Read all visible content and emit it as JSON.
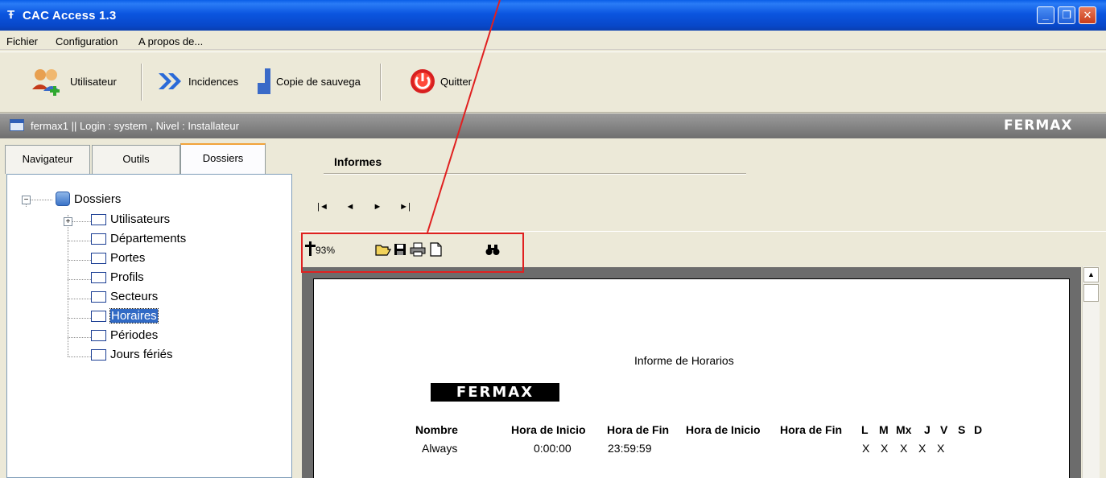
{
  "window": {
    "title": "CAC Access 1.3",
    "icon": "app-icon",
    "minimize": "_",
    "maximize": "❐",
    "close": "✕"
  },
  "menu": [
    "Fichier",
    "Configuration",
    "A propos de..."
  ],
  "toolbar": {
    "utilisateur": "Utilisateur",
    "incidences": "Incidences",
    "copie": "Copie de sauvega",
    "quitter": "Quitter"
  },
  "session": {
    "text": "fermax1  || Login : system , Nivel : Installateur",
    "brand": "FERMAX"
  },
  "tabs": [
    "Navigateur",
    "Outils",
    "Dossiers"
  ],
  "tabs_active": "Dossiers",
  "tree": {
    "root": "Dossiers",
    "items": [
      "Utilisateurs",
      "Départements",
      "Portes",
      "Profils",
      "Secteurs",
      "Horaires",
      "Périodes",
      "Jours fériés"
    ],
    "selected": "Horaires"
  },
  "report_viewer": {
    "section_title": "Informes",
    "nav": [
      "|◄",
      "◄",
      "►",
      "►|"
    ],
    "zoom": "93%",
    "icons": [
      "zoom-icon",
      "open-folder-icon",
      "save-icon",
      "print-icon",
      "page-icon",
      "find-icon"
    ]
  },
  "report": {
    "title": "Informe de Horarios",
    "logo": "FERMAX",
    "columns": [
      "Nombre",
      "Hora de Inicio",
      "Hora de Fin",
      "Hora de Inicio",
      "Hora de Fin",
      "L",
      "M",
      "Mx",
      "J",
      "V",
      "S",
      "D"
    ],
    "rows": [
      [
        "Always",
        "0:00:00",
        "23:59:59",
        "",
        "",
        "X",
        "X",
        "X",
        "X",
        "X",
        "",
        ""
      ]
    ]
  },
  "colors": {
    "titlebar": "#0b55e0",
    "callout": "#e02020",
    "selection": "#316ac5"
  }
}
